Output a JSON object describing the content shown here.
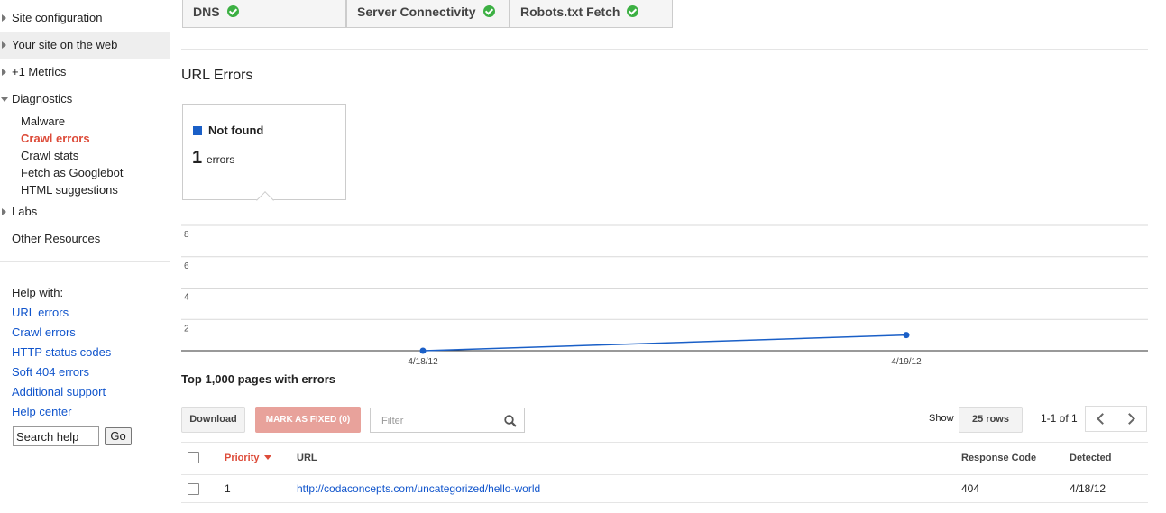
{
  "sidebar": {
    "nav": [
      {
        "label": "Site configuration",
        "expanded": false,
        "active": false
      },
      {
        "label": "Your site on the web",
        "expanded": false,
        "active": true
      },
      {
        "label": "+1 Metrics",
        "expanded": false,
        "active": false
      },
      {
        "label": "Diagnostics",
        "expanded": true,
        "active": false
      }
    ],
    "diagnostics_items": [
      "Malware",
      "Crawl errors",
      "Crawl stats",
      "Fetch as Googlebot",
      "HTML suggestions"
    ],
    "current_item": "Crawl errors",
    "labs": "Labs",
    "other_resources": "Other Resources",
    "help_with": "Help with:",
    "help_links": [
      "URL errors",
      "Crawl errors",
      "HTTP status codes",
      "Soft 404 errors",
      "Additional support",
      "Help center"
    ],
    "search_value": "Search help",
    "go_label": "Go"
  },
  "status": [
    {
      "label": "DNS",
      "ok": true
    },
    {
      "label": "Server Connectivity",
      "ok": true
    },
    {
      "label": "Robots.txt Fetch",
      "ok": true
    }
  ],
  "section_title": "URL Errors",
  "legend": {
    "name": "Not found",
    "count": "1",
    "unit": "errors",
    "color": "#1a5fc7"
  },
  "chart_data": {
    "type": "line",
    "x": [
      "4/18/12",
      "4/19/12"
    ],
    "series": [
      {
        "name": "Not found",
        "values": [
          0,
          1
        ]
      }
    ],
    "yticks": [
      2,
      4,
      6,
      8
    ],
    "ylim": [
      0,
      8
    ],
    "color": "#1a5fc7"
  },
  "table": {
    "title": "Top 1,000 pages with errors",
    "download_label": "Download",
    "mark_fixed_label": "MARK AS FIXED (0)",
    "filter_placeholder": "Filter",
    "show_label": "Show",
    "rows_label": "25 rows",
    "paging": "1-1 of 1",
    "columns": {
      "priority": "Priority",
      "url": "URL",
      "response_code": "Response Code",
      "detected": "Detected"
    },
    "rows": [
      {
        "priority": "1",
        "url": "http://codaconcepts.com/uncategorized/hello-world",
        "response_code": "404",
        "detected": "4/18/12"
      }
    ]
  }
}
